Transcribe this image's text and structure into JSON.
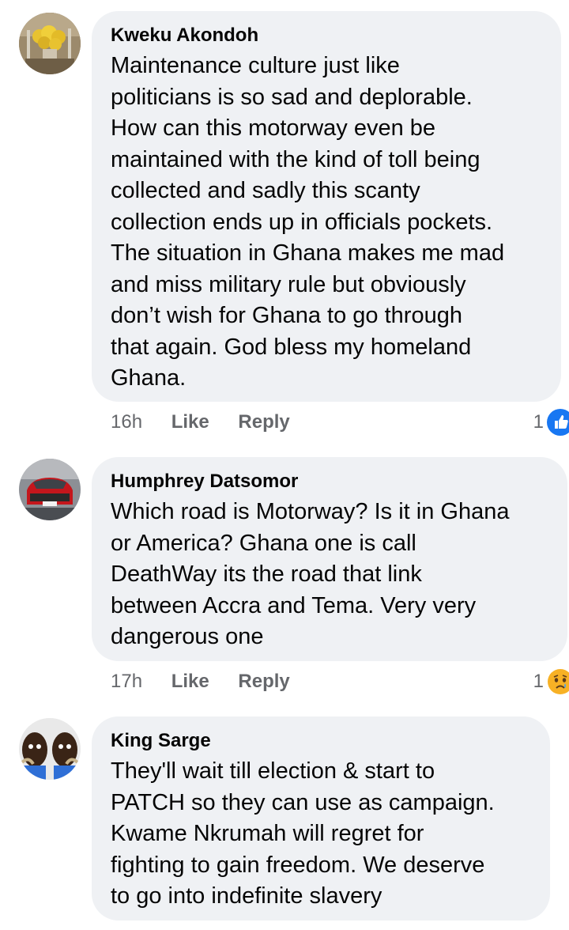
{
  "comments": [
    {
      "author": "Kweku Akondoh",
      "text": "Maintenance culture just like\npoliticians is so sad and deplorable.\nHow can this motorway even be\nmaintained with the kind of toll being\ncollected and sadly this scanty\ncollection ends up in officials pockets.\nThe situation in Ghana makes me mad\nand miss military rule but obviously\ndon’t wish for Ghana to go through\nthat again. God bless my homeland\nGhana.",
      "time": "16h",
      "like_label": "Like",
      "reply_label": "Reply",
      "reaction_count": "1",
      "reaction_icon": "like-icon",
      "reaction_color": "#1877f2"
    },
    {
      "author": "Humphrey Datsomor",
      "text": "Which road is Motorway? Is it in Ghana\nor America? Ghana one is call\nDeathWay its the road that link\nbetween Accra and Tema. Very very\ndangerous one",
      "time": "17h",
      "like_label": "Like",
      "reply_label": "Reply",
      "reaction_count": "1",
      "reaction_icon": "sad-icon",
      "reaction_color": "#f7b125"
    },
    {
      "author": "King Sarge",
      "text": "They'll wait till election & start to\nPATCH so they can use as campaign.\nKwame Nkrumah will regret for\nfighting to gain freedom. We deserve\nto go into indefinite slavery",
      "time": "",
      "like_label": "",
      "reply_label": "",
      "reaction_count": ""
    }
  ]
}
